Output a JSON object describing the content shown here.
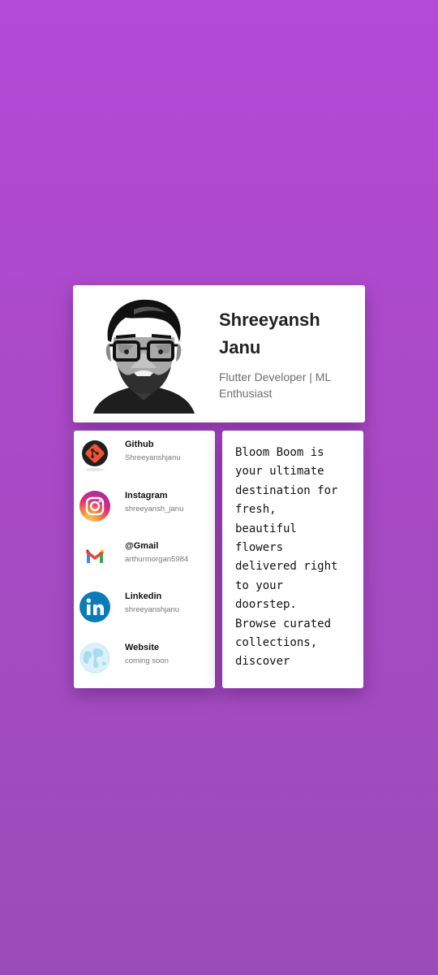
{
  "profile": {
    "name": "Shreeyansh Janu",
    "title": "Flutter Developer | ML Enthusiast"
  },
  "links": [
    {
      "name": "Github",
      "handle": "Shreeyanshjanu",
      "icon": "github-icon",
      "color": "#f05133"
    },
    {
      "name": "Instagram",
      "handle": "shreeyansh_janu",
      "icon": "instagram-icon",
      "color": "#dd2a7b"
    },
    {
      "name": "@Gmail",
      "handle": "arthurmorgan5984",
      "icon": "gmail-icon",
      "color": "#ea4335"
    },
    {
      "name": "Linkedin",
      "handle": "shreeyanshjanu",
      "icon": "linkedin-icon",
      "color": "#0a7bb8"
    },
    {
      "name": "Website",
      "handle": "coming soon",
      "icon": "globe-icon",
      "color": "#9fd6ef"
    }
  ],
  "bio": {
    "text": "Bloom Boom is\nyour ultimate\ndestination for\nfresh,\nbeautiful\nflowers\ndelivered right\nto your\ndoorstep.\nBrowse curated\ncollections,\ndiscover"
  },
  "colors": {
    "background_top": "#b44ad8",
    "background_bottom": "#9a4cb9",
    "card": "#ffffff"
  }
}
